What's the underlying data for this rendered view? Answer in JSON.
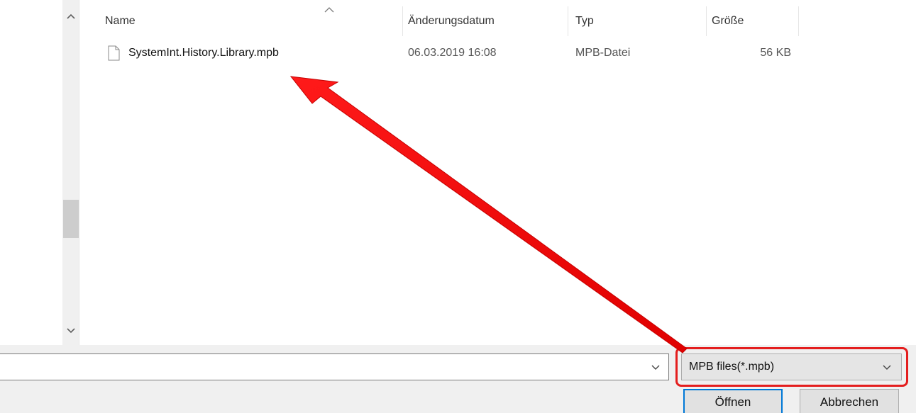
{
  "file_list": {
    "columns": {
      "name": "Name",
      "modified": "Änderungsdatum",
      "type": "Typ",
      "size": "Größe"
    },
    "rows": [
      {
        "name": "SystemInt.History.Library.mpb",
        "modified": "06.03.2019 16:08",
        "type": "MPB-Datei",
        "size": "56 KB"
      }
    ]
  },
  "bottom_bar": {
    "filename_value": "",
    "filter_selected": "MPB files(*.mpb)",
    "open_label": "Öffnen",
    "cancel_label": "Abbrechen"
  },
  "icons": {
    "sort": "chevron-up-icon",
    "scroll_up": "scroll-up-icon",
    "scroll_down": "scroll-down-icon",
    "file": "document-icon",
    "dropdown": "chevron-down-icon"
  },
  "colors": {
    "highlight": "#e41e1e",
    "arrow": "#ff0000",
    "focus_border": "#0078d7"
  }
}
